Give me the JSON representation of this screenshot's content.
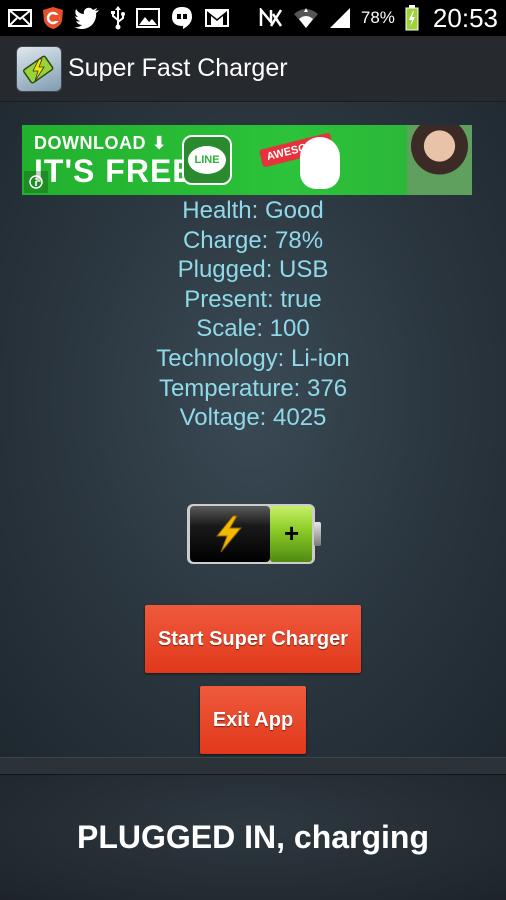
{
  "status_bar": {
    "icons_left": [
      "mail-icon",
      "shield-icon",
      "twitter-icon",
      "usb-icon",
      "image-icon",
      "hangouts-icon",
      "gmail-icon"
    ],
    "icons_right": [
      "nfc-icon",
      "wifi-icon",
      "signal-icon",
      "battery-charging-icon"
    ],
    "battery_percent": "78%",
    "time": "20:53"
  },
  "action_bar": {
    "app_icon": "battery-app-icon",
    "title": "Super Fast Charger"
  },
  "ad": {
    "line1": "DOWNLOAD",
    "line2": "IT'S FREE!",
    "logo_text": "LINE",
    "sticker_text": "AWESOME!",
    "colors": {
      "background": "#2cc23a"
    }
  },
  "battery_info": {
    "health": "Health: Good",
    "charge": "Charge: 78%",
    "plugged": "Plugged: USB",
    "present": "Present: true",
    "scale": "Scale: 100",
    "technology": "Technology: Li-ion",
    "temperature": "Temperature: 376",
    "voltage": "Voltage: 4025"
  },
  "battery_graphic": {
    "icon": "lightning-icon",
    "plus": "+",
    "colors": {
      "charged": "#8fcf2a",
      "empty": "#111111",
      "bolt": "#f5b800"
    }
  },
  "buttons": {
    "start_label": "Start Super Charger",
    "exit_label": "Exit App",
    "color": "#e64a2a"
  },
  "footer": {
    "status": "PLUGGED IN, charging"
  },
  "colors": {
    "stats_text": "#8fd9e8",
    "action_bar": "#262a2e"
  }
}
